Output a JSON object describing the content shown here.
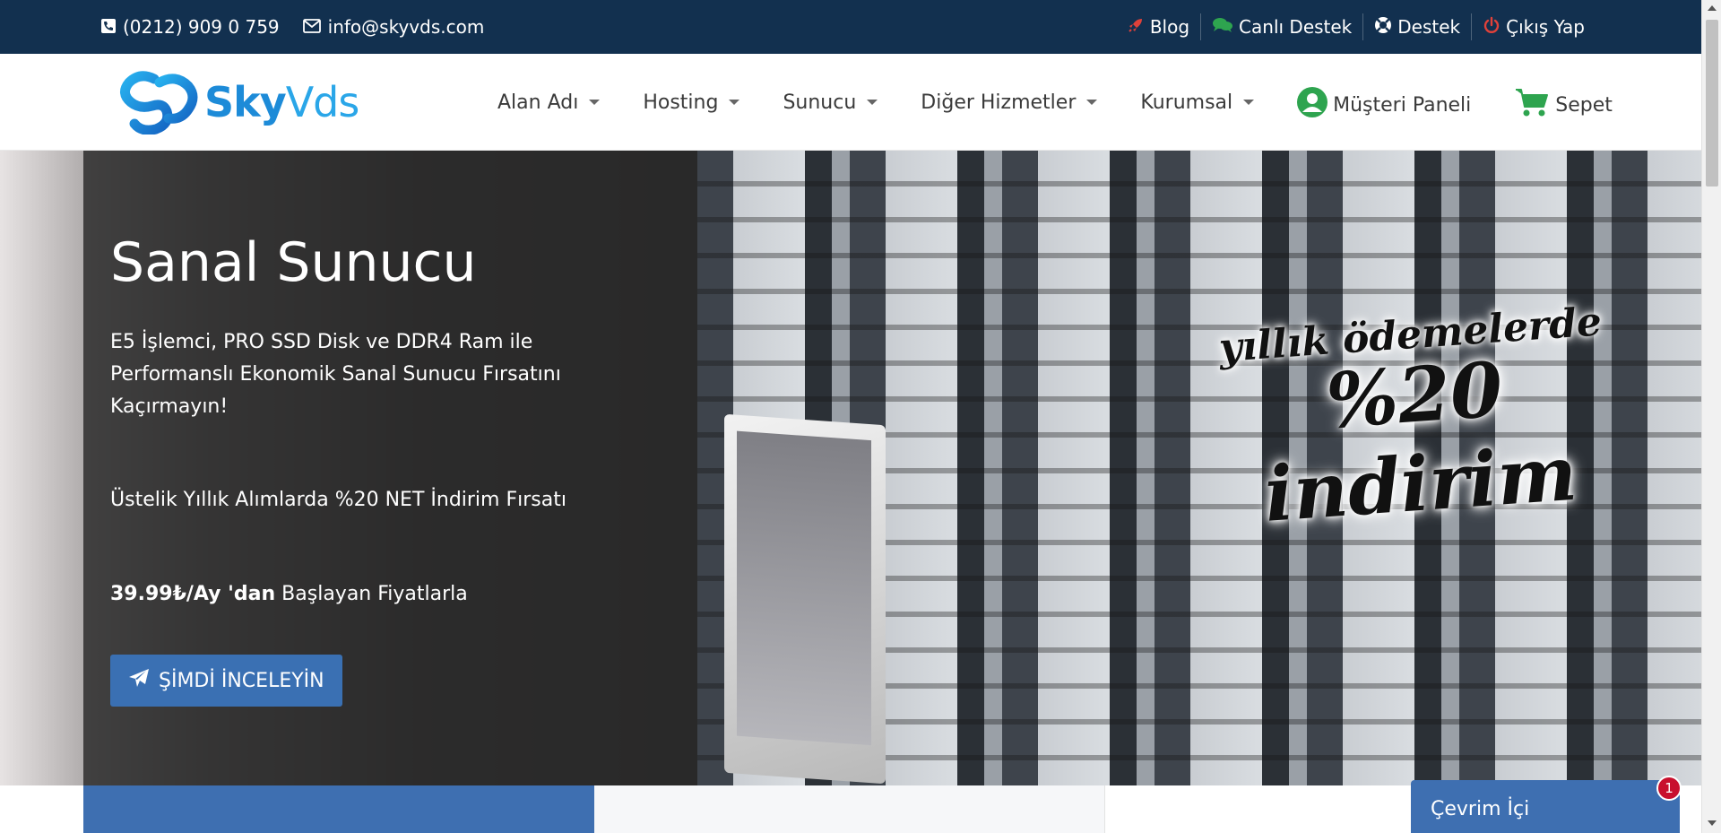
{
  "topbar": {
    "phone": "(0212) 909 0 759",
    "email": "info@skyvds.com",
    "links": [
      {
        "label": "Blog",
        "icon": "rocket-icon"
      },
      {
        "label": "Canlı Destek",
        "icon": "chat-icon"
      },
      {
        "label": "Destek",
        "icon": "lifebuoy-icon"
      },
      {
        "label": "Çıkış Yap",
        "icon": "power-icon"
      }
    ]
  },
  "header": {
    "logo_sky": "Sky",
    "logo_vds": "Vds",
    "menu": [
      "Alan Adı",
      "Hosting",
      "Sunucu",
      "Diğer Hizmetler",
      "Kurumsal"
    ],
    "panel_label": "Müşteri Paneli",
    "cart_label": "Sepet"
  },
  "hero": {
    "title": "Sanal Sunucu",
    "description": "E5 İşlemci, PRO SSD Disk ve DDR4 Ram ile Performanslı Ekonomik Sanal Sunucu Fırsatını Kaçırmayın!",
    "offer": "Üstelik Yıllık Alımlarda %20 NET İndirim Fırsatı",
    "price_bold": "39.99₺/Ay 'dan",
    "price_rest": " Başlayan Fiyatlarla",
    "button_label": "ŞİMDİ İNCELEYİN",
    "promo_line1": "yıllık ödemelerde",
    "promo_line2": "%20 indirim"
  },
  "chat": {
    "label": "Çevrim İçi",
    "badge": "1"
  },
  "colors": {
    "topbar": "#12304f",
    "accent": "#3e6fb1",
    "green": "#2ea44f",
    "logo": "#1d8bd8"
  }
}
